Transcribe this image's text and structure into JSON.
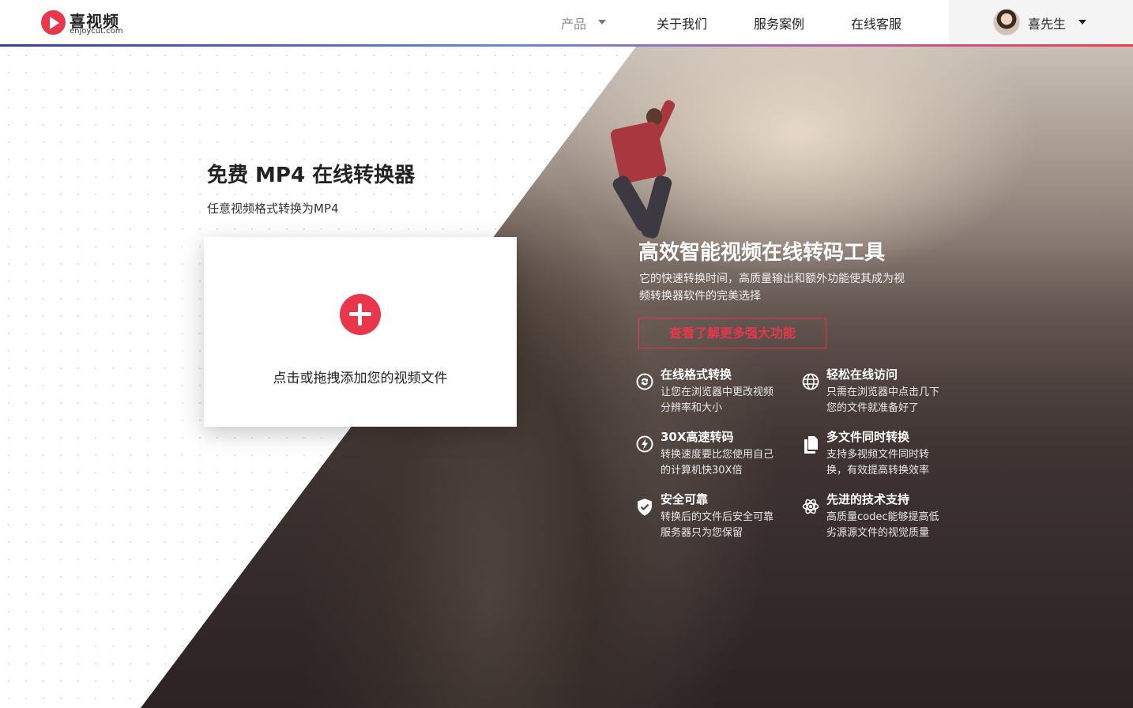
{
  "brand": {
    "name": "喜视频",
    "domain": "enjoycut.com",
    "accent": "#e8374a"
  },
  "nav": {
    "items": [
      {
        "label": "产品",
        "has_dropdown": true
      },
      {
        "label": "关于我们"
      },
      {
        "label": "服务案例"
      },
      {
        "label": "在线客服"
      }
    ]
  },
  "user": {
    "name": "喜先生",
    "avatar_icon": "avatar"
  },
  "hero": {
    "title": "免费 MP4 在线转换器",
    "subtitle": "任意视频格式转换为MP4",
    "upload": {
      "label": "点击或拖拽添加您的视频文件",
      "icon": "plus-icon"
    }
  },
  "promo": {
    "title": "高效智能视频在线转码工具",
    "description": "它的快速转换时间，高质量输出和额外功能使其成为视频转换器软件的完美选择",
    "button_label": "查看了解更多强大功能"
  },
  "features": [
    {
      "icon": "sync-icon",
      "title": "在线格式转换",
      "desc": "让您在浏览器中更改视频分辨率和大小"
    },
    {
      "icon": "globe-icon",
      "title": "轻松在线访问",
      "desc": "只需在浏览器中点击几下 您的文件就准备好了"
    },
    {
      "icon": "lightning-icon",
      "title": "30X高速转码",
      "desc": "转换速度要比您使用自己的计算机快30X倍"
    },
    {
      "icon": "files-icon",
      "title": "多文件同时转换",
      "desc": "支持多视频文件同时转换，有效提高转换效率"
    },
    {
      "icon": "shield-check-icon",
      "title": "安全可靠",
      "desc": "转换后的文件后安全可靠服务器只为您保留"
    },
    {
      "icon": "atom-icon",
      "title": "先进的技术支持",
      "desc": "高质量codec能够提高低劣源源文件的视觉质量"
    }
  ]
}
